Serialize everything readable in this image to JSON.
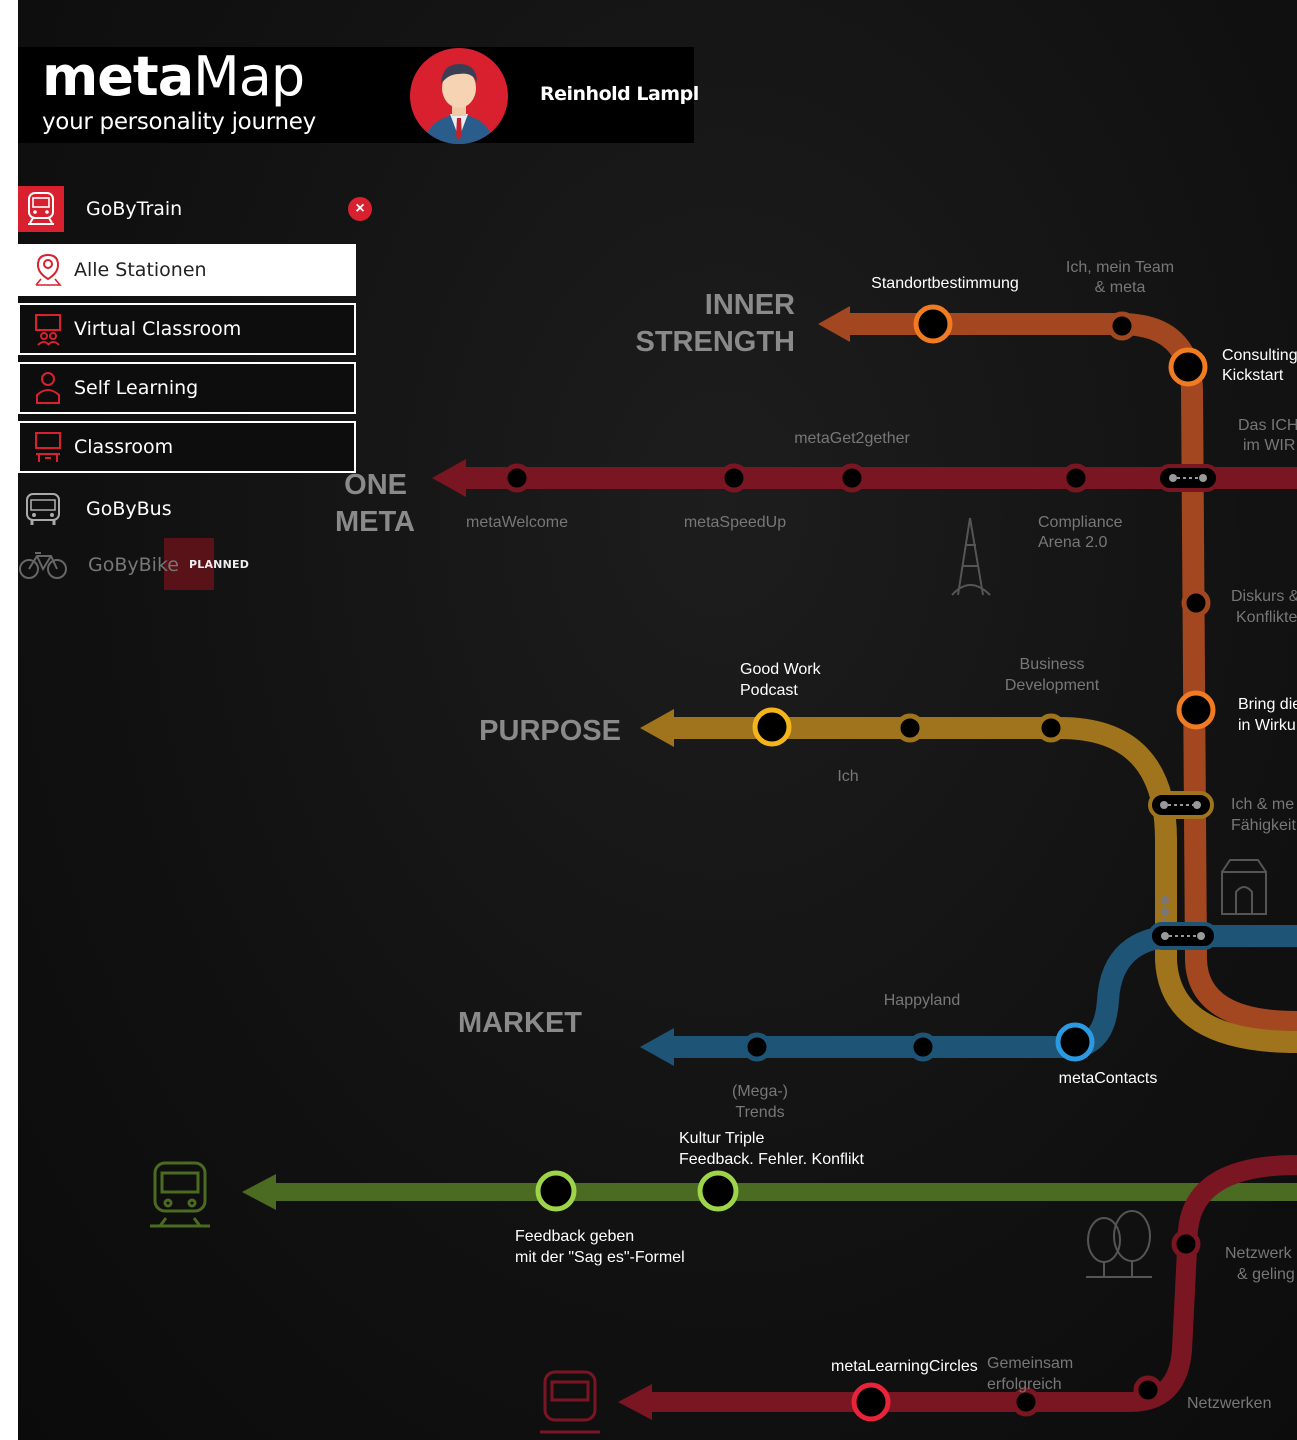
{
  "header": {
    "logo_bold": "meta",
    "logo_light": "Map",
    "tagline": "your personality journey",
    "user_name": "Reinhold Lampl"
  },
  "menu": {
    "train_label": "GoByTrain",
    "stations": [
      {
        "label": "Alle Stationen",
        "active": true
      },
      {
        "label": "Virtual Classroom",
        "active": false
      },
      {
        "label": "Self Learning",
        "active": false
      },
      {
        "label": "Classroom",
        "active": false
      }
    ],
    "bus_label": "GoByBus",
    "bike_label": "GoByBike",
    "planned_badge": "PLANNED"
  },
  "map": {
    "zones": {
      "inner_strength": [
        "INNER",
        "STRENGTH"
      ],
      "one_meta": [
        "ONE",
        "META"
      ],
      "purpose": "PURPOSE",
      "market": "MARKET"
    },
    "labels": {
      "standortbestimmung": "Standortbestimmung",
      "ich_mein_team": [
        "Ich, mein Team",
        "& meta"
      ],
      "consulting_kickstart": [
        "Consulting",
        "Kickstart"
      ],
      "das_ich": [
        "Das ICH",
        "im WIR"
      ],
      "metaget2gether": "metaGet2gether",
      "metawelcome": "metaWelcome",
      "metaspeedup": "metaSpeedUp",
      "compliance": [
        "Compliance",
        "Arena 2.0"
      ],
      "diskurs": [
        "Diskurs &",
        "Konflikte"
      ],
      "good_work": [
        "Good Work",
        "Podcast"
      ],
      "business_dev": [
        "Business",
        "Development"
      ],
      "bring_die": [
        "Bring die",
        "in Wirku"
      ],
      "ich": "Ich",
      "ich_meine": [
        "Ich & me",
        "Fähigkeit"
      ],
      "happyland": "Happyland",
      "metacontacts": "metaContacts",
      "mega_trends": [
        "(Mega-)",
        "Trends"
      ],
      "kultur_triple": [
        "Kultur Triple",
        "Feedback. Fehler. Konflikt"
      ],
      "feedback_geben": [
        "Feedback geben",
        "mit der \"Sag es\"-Formel"
      ],
      "netzwerk": [
        "Netzwerk",
        "& geling"
      ],
      "metalearningcircles": "metaLearningCircles",
      "gemeinsam": [
        "Gemeinsam",
        "erfolgreich"
      ],
      "netzwerken": "Netzwerken"
    },
    "colors": {
      "inner_strength": "#a2471f",
      "one_meta": "#7a1622",
      "purpose": "#a0741c",
      "market": "#1e5476",
      "green_line": "#4b6a22",
      "bottom_red": "#7a1622",
      "accent_red": "#d8202f"
    }
  }
}
